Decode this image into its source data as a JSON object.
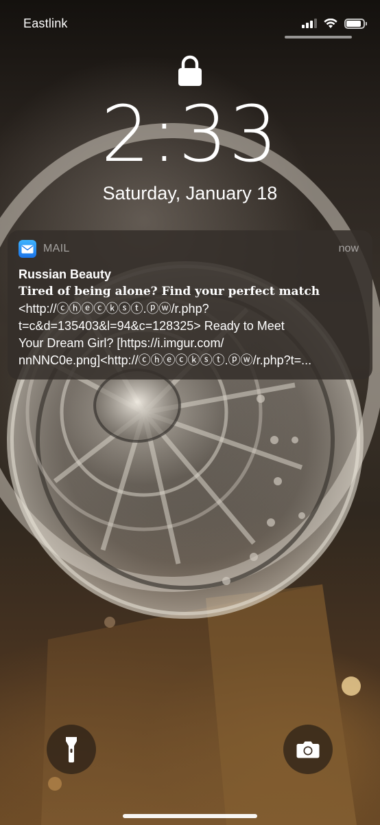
{
  "status_bar": {
    "carrier": "Eastlink",
    "signal_bars": 3,
    "signal_bars_total": 4,
    "battery_level": 0.9,
    "icons": [
      "signal-icon",
      "wifi-icon",
      "battery-icon"
    ]
  },
  "lock_screen": {
    "lock_icon": "lock-icon",
    "time": "2:33",
    "date": "Saturday, January 18"
  },
  "notification": {
    "app_icon": "mail-icon",
    "app_name": "MAIL",
    "time": "now",
    "title": "Russian Beauty",
    "subject": "Tired of being alone? Find your perfect match",
    "body_lines": [
      "<http://ⓒⓗⓔⓒⓚⓢⓣ.ⓟⓦ/r.php?",
      "t=c&d=135403&l=94&c=128325> Ready to Meet",
      "Your Dream Girl? [https://i.imgur.com/",
      "nnNNC0e.png]<http://ⓒⓗⓔⓒⓚⓢⓣ.ⓟⓦ/r.php?t=..."
    ],
    "accent_color": "#1a73e8"
  },
  "quick_actions": {
    "left_icon": "flashlight-icon",
    "right_icon": "camera-icon"
  }
}
